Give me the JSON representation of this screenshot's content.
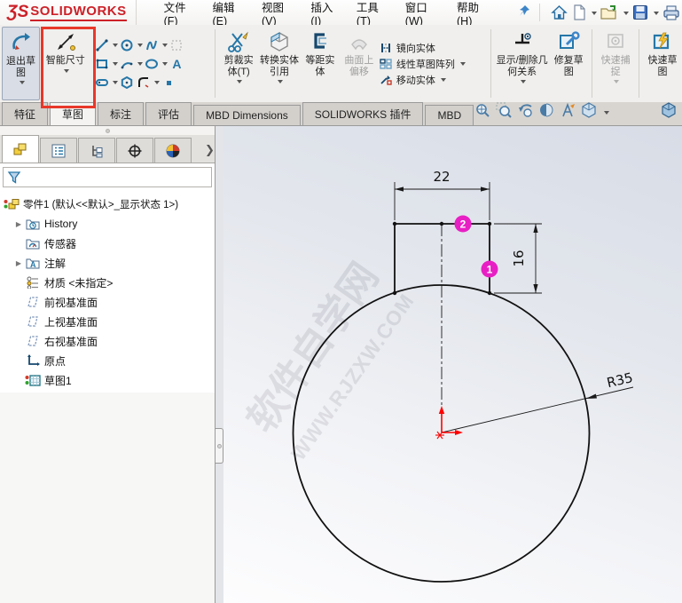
{
  "titlebar": {
    "brand_prefix": "ƷS",
    "brand": "SOLIDWORKS",
    "menus": [
      "文件(F)",
      "编辑(E)",
      "视图(V)",
      "插入(I)",
      "工具(T)",
      "窗口(W)",
      "帮助(H)"
    ]
  },
  "commandbar": {
    "exit_sketch": "退出草图",
    "smart_dimension": "智能尺寸",
    "trim": "剪裁实体(T)",
    "convert": "转换实体引用",
    "offset": "等距实体",
    "surface_offset": "曲面上偏移",
    "mirror": "镜向实体",
    "linear_pattern": "线性草图阵列",
    "move": "移动实体",
    "relations": "显示/删除几何关系",
    "repair": "修复草图",
    "quick_snaps": "快速捕捉",
    "rapid_sketch": "快速草图"
  },
  "ribbon_tabs": [
    "特征",
    "草图",
    "标注",
    "评估",
    "MBD Dimensions",
    "SOLIDWORKS 插件",
    "MBD"
  ],
  "tree": {
    "root": "零件1 (默认<<默认>_显示状态 1>)",
    "items": [
      "History",
      "传感器",
      "注解",
      "材质 <未指定>",
      "前视基准面",
      "上视基准面",
      "右视基准面",
      "原点",
      "草图1"
    ]
  },
  "sketch": {
    "dim_width": "22",
    "dim_height": "16",
    "dim_radius": "R35",
    "badge_1": "1",
    "badge_2": "2"
  },
  "watermark": {
    "line1": "软件自学网",
    "line2": "WWW.RJZXW.COM"
  },
  "colors": {
    "highlight_box": "#e8382a",
    "badge": "#e820c4",
    "origin": "#ff0000",
    "icon_blue": "#2677a8"
  }
}
